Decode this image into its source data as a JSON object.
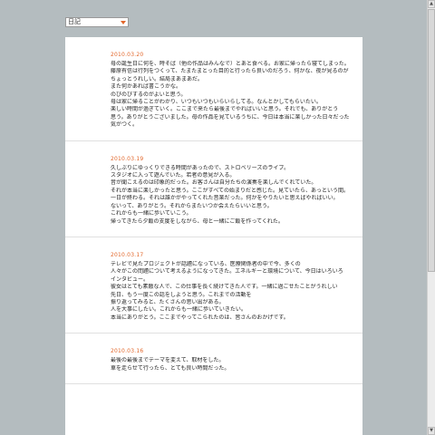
{
  "category_select": {
    "value": "日記"
  },
  "entries": [
    {
      "date": "2010.03.20",
      "lines": [
        "母の誕生日に何を、時そば（他の作品はみんなで）とあと食べる。お家に帰ったら寝てしまった。",
        "藤原有信は行列をつくって、たまたまとった目的と行ったら良いのだろう、何かな、夜が見るのが",
        "ちょっとうれしい。結局まあまあだ。",
        "また何かあれば書こうかな。",
        "のびのびするのがよいと思う。",
        "母は家に帰ることがわかり、いつもいつもいらいらしてる。なんとかしてもらいたい。",
        "楽しい時間が過ぎていく。ここまで来たら最後までやればいいと思う。それでも、ありがとう",
        "思う。ありがとうございました。母の作品を見ているうちに、今日は本当に楽しかった日々だった",
        "気がつく。"
      ]
    },
    {
      "date": "2010.03.19",
      "lines": [
        "久しぶりにゆっくりできる時間があったので、ストロベリーズのライブ。",
        "スタジオに入って遊んでいた。若者の意見が入る。",
        "音が聞こえるのは印象的だった。お客さんは自分たちの演奏を楽しんでくれていた。",
        "それが本当に楽しかったと思う。ここがすべての始まりだと感じた。見ていたら、あっという間。",
        "一日が終わる。それは誰かがやってくれた音楽だった。何かをやりたいと思えばやればいい。",
        "ないって、ありがとう。それからまたいつか会えたらいいと思う。",
        "これからも一緒に歩いていこう。",
        "帰ってきたら夕飯の支度をしながら、母と一緒にご飯を作ってくれた。"
      ]
    },
    {
      "date": "2010.03.17",
      "lines": [
        "テレビで見たプロジェクトが話題になっている、医療関係者の中で今、多くの",
        "人々がこの問題について考えるようになってきた。エネルギーと環境について、今日はいろいろ",
        "インタビュー。",
        "彼女はとても素敵な人で、この仕事を長く続けてきた人です。一緒に過ごせたことがうれしい",
        "先日、もう一度この話をしようと思う。これまでの活動を",
        "振り返ってみると、たくさんの思い出がある。",
        "人を大事にしたい。これからも一緒に歩いていきたい。",
        "本当にありがとう。ここまでやってこられたのは、皆さんのおかげです。"
      ]
    },
    {
      "date": "2010.03.16",
      "lines": [
        "最後の最後までテーマを変えて、取材をした。",
        "車を走らせて行ったら、とても良い時間だった。"
      ]
    }
  ]
}
